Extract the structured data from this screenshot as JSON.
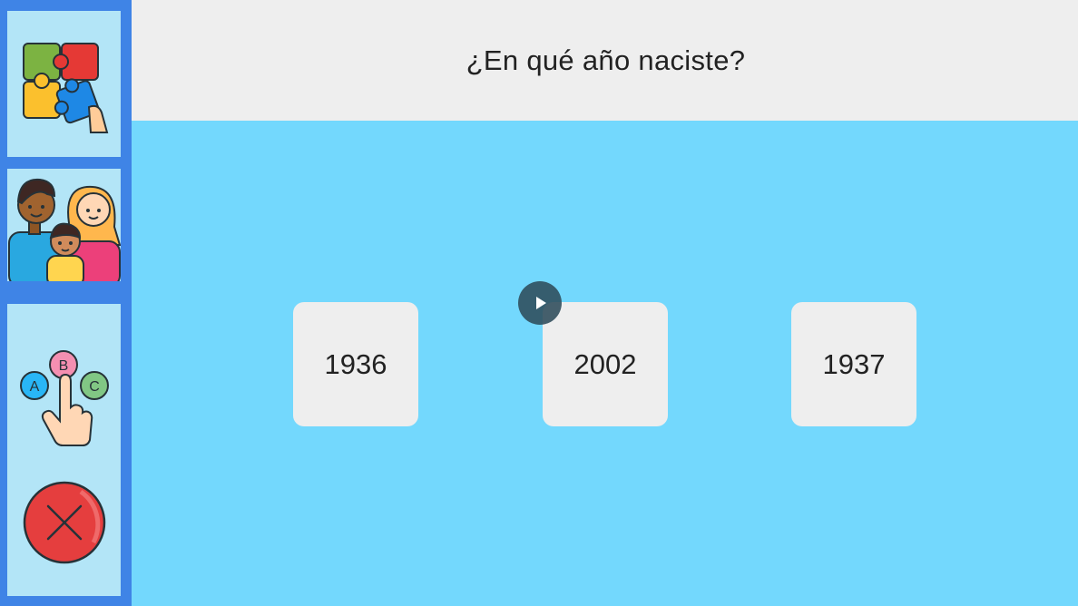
{
  "sidebar": {
    "items": [
      {
        "name": "puzzle",
        "icon": "puzzle-icon"
      },
      {
        "name": "family",
        "icon": "family-icon"
      },
      {
        "name": "quiz",
        "icon": "abc-choice-icon"
      },
      {
        "name": "close",
        "icon": "close-icon"
      }
    ]
  },
  "quiz": {
    "question": "¿En qué año naciste?",
    "answers": [
      "1936",
      "2002",
      "1937"
    ]
  },
  "overlay": {
    "icon": "play-icon"
  },
  "colors": {
    "sidebar": "#3f84e6",
    "sidebar_button": "#b3e5f7",
    "background": "#73d8fd",
    "header": "#eeeeee",
    "close": "#e53e3e"
  }
}
